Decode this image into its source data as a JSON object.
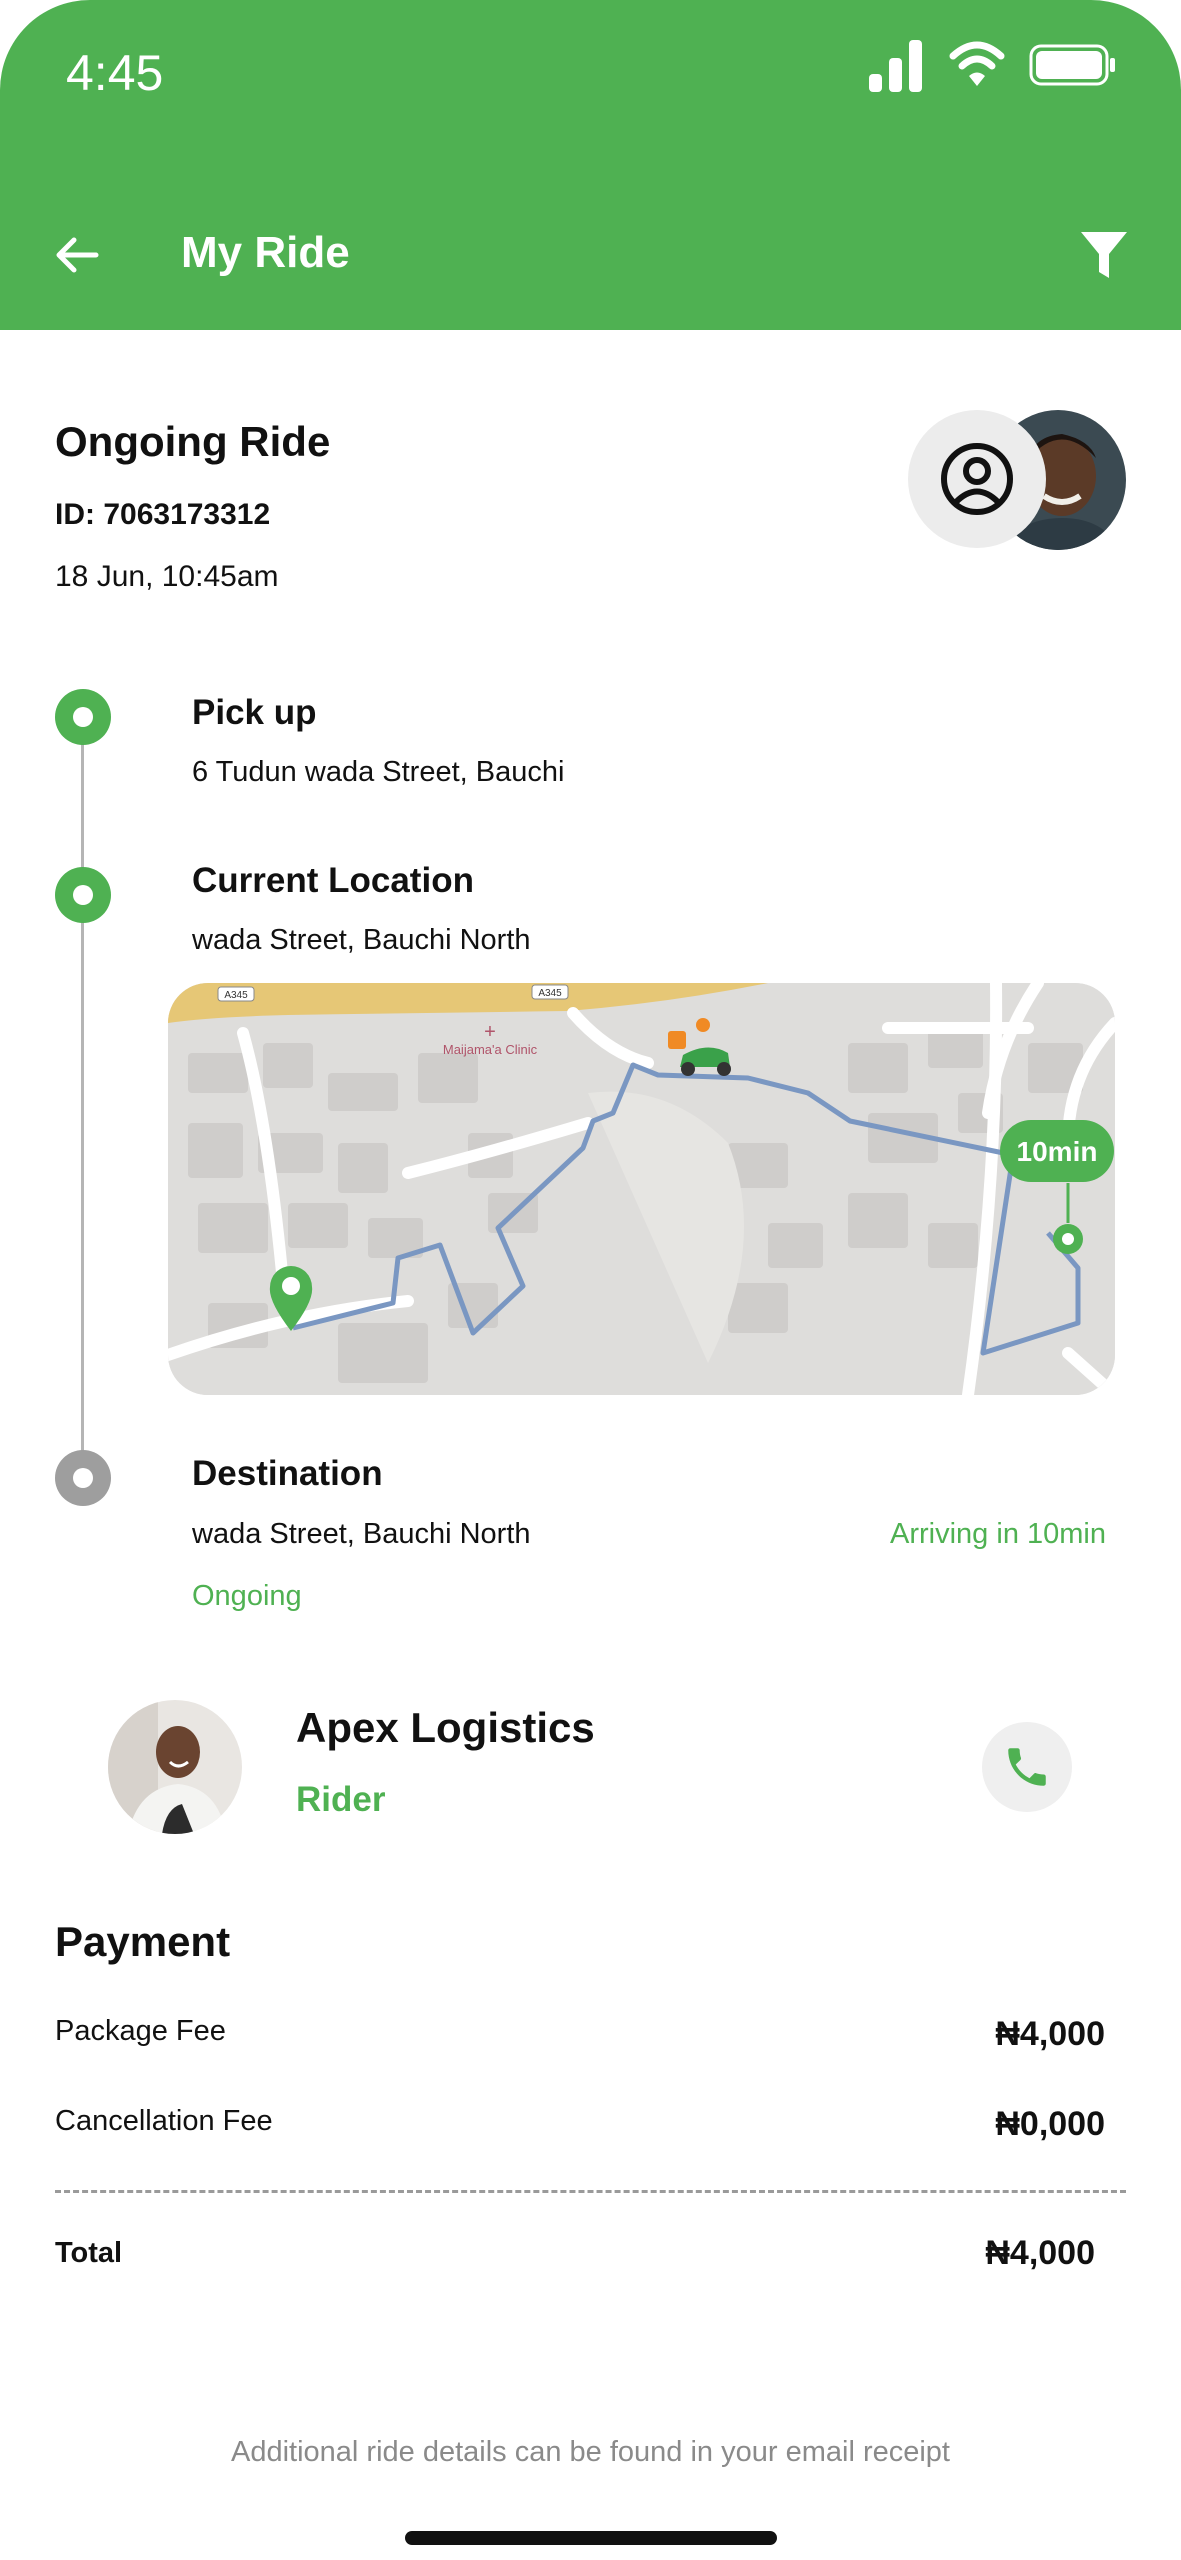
{
  "status_bar": {
    "time": "4:45",
    "icons": [
      "signal-icon",
      "wifi-icon",
      "battery-icon"
    ]
  },
  "nav": {
    "title": "My Ride",
    "back_icon": "arrow-left-icon",
    "filter_icon": "filter-icon"
  },
  "ride": {
    "title": "Ongoing Ride",
    "id": "ID: 7063173312",
    "date": "18 Jun, 10:45am"
  },
  "timeline": {
    "pickup": {
      "label": "Pick up",
      "address": "6 Tudun wada Street, Bauchi"
    },
    "current": {
      "label": "Current Location",
      "address": "wada Street, Bauchi North"
    },
    "destination": {
      "label": "Destination",
      "address": "wada Street, Bauchi North",
      "eta": "Arriving in 10min",
      "status": "Ongoing"
    }
  },
  "map": {
    "eta_badge": "10min",
    "place_label": "Maijama'a Clinic",
    "road_labels": [
      "A345",
      "A345"
    ]
  },
  "rider": {
    "name": "Apex Logistics",
    "role": "Rider"
  },
  "payment": {
    "title": "Payment",
    "rows": [
      {
        "label": "Package Fee",
        "value": "₦4,000"
      },
      {
        "label": "Cancellation Fee",
        "value": "₦0,000"
      }
    ],
    "total_label": "Total",
    "total_value": "₦4,000"
  },
  "footer": {
    "note": "Additional ride details can be found in your email receipt"
  },
  "colors": {
    "accent": "#4fb152",
    "inactive": "#9e9e9e",
    "route": "#7a97c2"
  }
}
